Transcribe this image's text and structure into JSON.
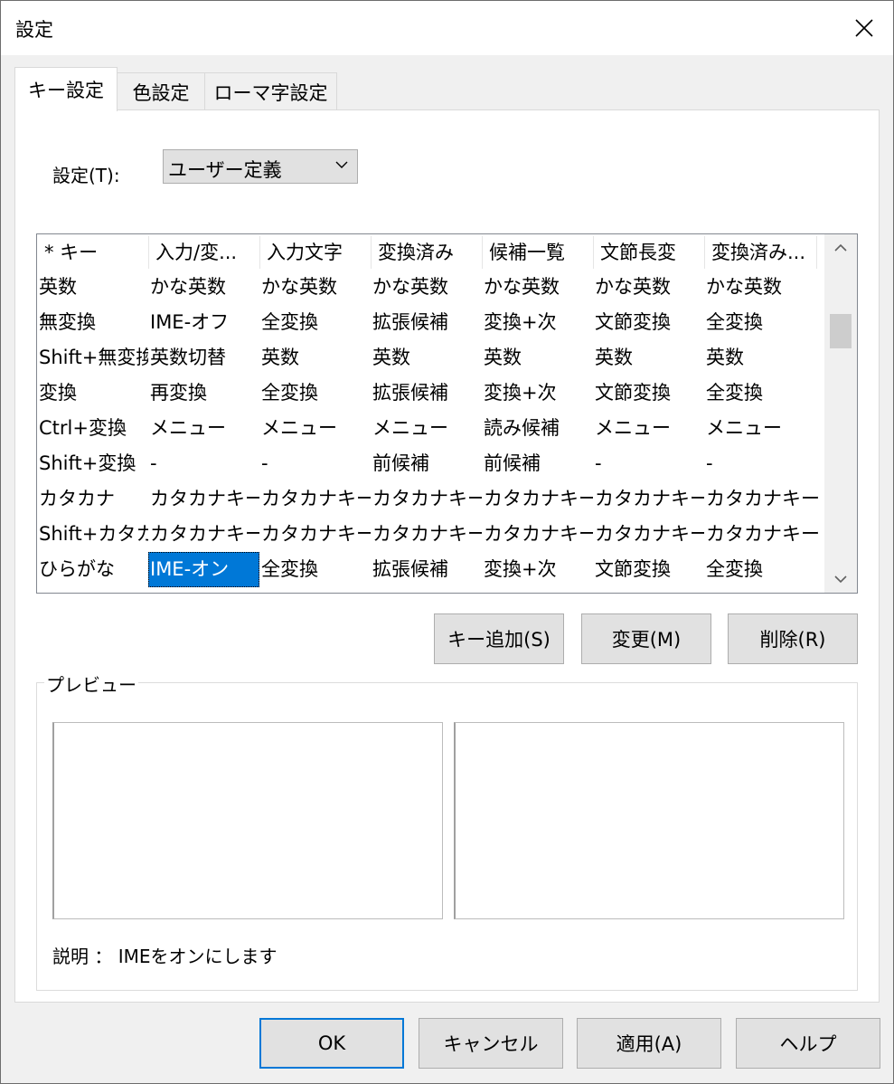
{
  "window": {
    "title": "設定"
  },
  "tabs": [
    {
      "label": "キー設定",
      "active": true
    },
    {
      "label": "色設定",
      "active": false
    },
    {
      "label": "ローマ字設定",
      "active": false
    }
  ],
  "settings": {
    "label": "設定(T):",
    "combo_value": "ユーザー定義"
  },
  "table": {
    "columns": [
      "* キー",
      "入力/変...",
      "入力文字",
      "変換済み",
      "候補一覧",
      "文節長変",
      "変換済み..."
    ],
    "rows": [
      [
        "英数",
        "かな英数",
        "かな英数",
        "かな英数",
        "かな英数",
        "かな英数",
        "かな英数"
      ],
      [
        "無変換",
        "IME-オフ",
        "全変換",
        "拡張候補",
        "変換+次",
        "文節変換",
        "全変換"
      ],
      [
        "Shift+無変換",
        "英数切替",
        "英数",
        "英数",
        "英数",
        "英数",
        "英数"
      ],
      [
        "変換",
        "再変換",
        "全変換",
        "拡張候補",
        "変換+次",
        "文節変換",
        "全変換"
      ],
      [
        "Ctrl+変換",
        "メニュー",
        "メニュー",
        "メニュー",
        "読み候補",
        "メニュー",
        "メニュー"
      ],
      [
        "Shift+変換",
        "-",
        "-",
        "前候補",
        "前候補",
        "-",
        "-"
      ],
      [
        "カタカナ",
        "カタカナキー",
        "カタカナキー",
        "カタカナキー",
        "カタカナキー",
        "カタカナキー",
        "カタカナキー"
      ],
      [
        "Shift+カタカナ",
        "カタカナキー",
        "カタカナキー",
        "カタカナキー",
        "カタカナキー",
        "カタカナキー",
        "カタカナキー"
      ],
      [
        "ひらがな",
        "IME-オン",
        "全変換",
        "拡張候補",
        "変換+次",
        "文節変換",
        "全変換"
      ]
    ],
    "selected": {
      "row": 8,
      "col": 1
    }
  },
  "actions": {
    "add": "キー追加(S)",
    "change": "変更(M)",
    "delete": "削除(R)"
  },
  "preview": {
    "title": "プレビュー",
    "description": "説明 ： IMEをオンにします"
  },
  "footer": {
    "ok": "OK",
    "cancel": "キャンセル",
    "apply": "適用(A)",
    "help": "ヘルプ"
  },
  "colors": {
    "selection": "#0078d7",
    "default_button_border": "#0078d7"
  }
}
